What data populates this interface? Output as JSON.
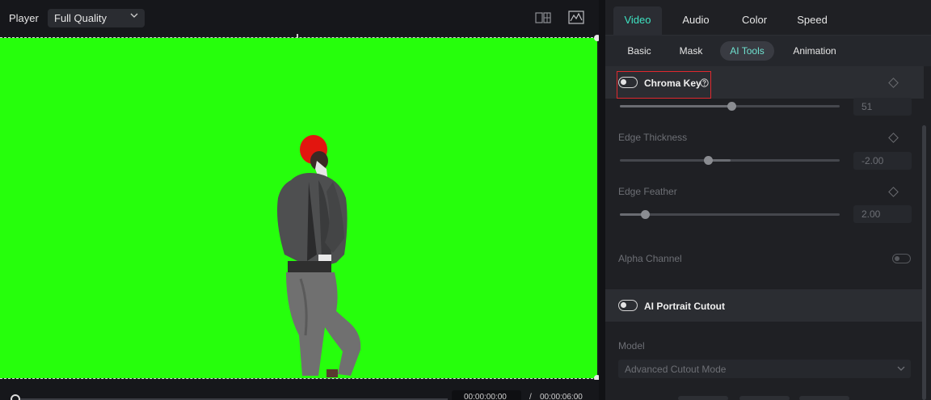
{
  "player": {
    "label": "Player",
    "quality": "Full Quality",
    "timecode_current": "00:00:00:00",
    "timecode_separator": "/",
    "timecode_total": "00:00:06:00"
  },
  "tabs": [
    "Video",
    "Audio",
    "Color",
    "Speed"
  ],
  "active_tab": "Video",
  "subtabs": [
    "Basic",
    "Mask",
    "AI Tools",
    "Animation"
  ],
  "active_subtab": "AI Tools",
  "chroma_key": {
    "title": "Chroma Key",
    "enabled": false,
    "first_slider_value": "51",
    "edge_thickness": {
      "label": "Edge Thickness",
      "value": "-2.00"
    },
    "edge_feather": {
      "label": "Edge Feather",
      "value": "2.00"
    },
    "alpha_channel": {
      "label": "Alpha Channel",
      "enabled": false
    }
  },
  "ai_portrait": {
    "title": "AI Portrait Cutout",
    "enabled": false,
    "model_label": "Model",
    "model_value": "Advanced Cutout Mode"
  },
  "colors": {
    "accent": "#3ee3c2",
    "green_screen": "#26ff0c",
    "highlight_box": "#e0282e"
  }
}
